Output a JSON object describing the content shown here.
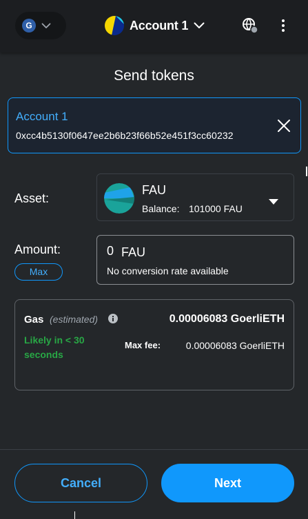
{
  "header": {
    "network_initial": "G",
    "account_name": "Account 1"
  },
  "page": {
    "title": "Send tokens"
  },
  "recipient": {
    "name": "Account 1",
    "address": "0xcc4b5130f0647ee2b6b23f66b52e451f3cc60232"
  },
  "asset": {
    "label": "Asset:",
    "symbol": "FAU",
    "balance_label": "Balance:",
    "balance_value": "101000 FAU"
  },
  "amount": {
    "label": "Amount:",
    "value": "0",
    "unit": "FAU",
    "conversion": "No conversion rate available",
    "max_label": "Max"
  },
  "gas": {
    "title": "Gas",
    "estimated": "(estimated)",
    "amount": "0.00006083 GoerliETH",
    "likelihood": "Likely in < 30 seconds",
    "max_fee_label": "Max fee:",
    "max_fee_value": "0.00006083 GoerliETH"
  },
  "footer": {
    "cancel_label": "Cancel",
    "next_label": "Next"
  },
  "colors": {
    "accent": "#1098fc",
    "accent_text": "#43aefc",
    "success": "#28a745",
    "background": "#24272a",
    "header": "#1c1e21"
  },
  "icons": [
    "chevron-down-icon",
    "account-avatar-icon",
    "globe-icon",
    "kebab-menu-icon",
    "close-icon",
    "token-icon",
    "caret-down-icon",
    "info-icon"
  ]
}
